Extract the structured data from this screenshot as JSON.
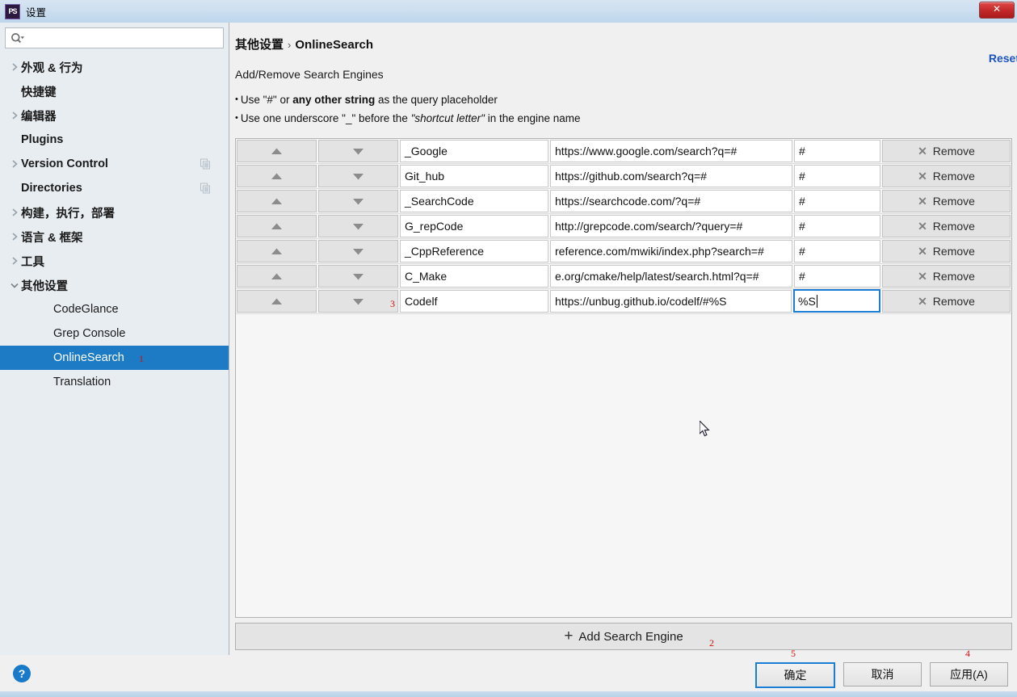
{
  "window": {
    "title": "设置",
    "app_icon": "PS",
    "close_label": "✕"
  },
  "sidebar": {
    "search": {
      "placeholder": "",
      "value": "",
      "icon": "search-icon"
    },
    "items": [
      {
        "label": "外观 & 行为",
        "arrow": "right",
        "bold": true,
        "child": false,
        "selected": false,
        "copy": false
      },
      {
        "label": "快捷键",
        "arrow": "none",
        "bold": true,
        "child": false,
        "selected": false,
        "copy": false
      },
      {
        "label": "编辑器",
        "arrow": "right",
        "bold": true,
        "child": false,
        "selected": false,
        "copy": false
      },
      {
        "label": "Plugins",
        "arrow": "none",
        "bold": true,
        "child": false,
        "selected": false,
        "copy": false
      },
      {
        "label": "Version Control",
        "arrow": "right",
        "bold": true,
        "child": false,
        "selected": false,
        "copy": true
      },
      {
        "label": "Directories",
        "arrow": "none",
        "bold": true,
        "child": false,
        "selected": false,
        "copy": true
      },
      {
        "label": "构建，执行，部署",
        "arrow": "right",
        "bold": true,
        "child": false,
        "selected": false,
        "copy": false
      },
      {
        "label": "语言 & 框架",
        "arrow": "right",
        "bold": true,
        "child": false,
        "selected": false,
        "copy": false
      },
      {
        "label": "工具",
        "arrow": "right",
        "bold": true,
        "child": false,
        "selected": false,
        "copy": false
      },
      {
        "label": "其他设置",
        "arrow": "down",
        "bold": true,
        "child": false,
        "selected": false,
        "copy": false
      },
      {
        "label": "CodeGlance",
        "arrow": "none",
        "bold": false,
        "child": true,
        "selected": false,
        "copy": false
      },
      {
        "label": "Grep Console",
        "arrow": "none",
        "bold": false,
        "child": true,
        "selected": false,
        "copy": false
      },
      {
        "label": "OnlineSearch",
        "arrow": "none",
        "bold": false,
        "child": true,
        "selected": true,
        "copy": false,
        "annotation": "1"
      },
      {
        "label": "Translation",
        "arrow": "none",
        "bold": false,
        "child": true,
        "selected": false,
        "copy": false
      }
    ]
  },
  "main": {
    "breadcrumb_parent": "其他设置",
    "breadcrumb_sep": "›",
    "breadcrumb_current": "OnlineSearch",
    "reset_label": "Reset",
    "section_title": "Add/Remove Search Engines",
    "hints": [
      {
        "bullet": "•",
        "pre": "Use \"#\" or ",
        "bold": "any other string",
        "post": " as the query placeholder",
        "italic": ""
      },
      {
        "bullet": "•",
        "pre": "Use one underscore \"_\" before the ",
        "bold": "",
        "italic": "\"shortcut letter\"",
        "post": " in the engine name"
      }
    ],
    "table": {
      "up_icon": "triangle-up-icon",
      "down_icon": "triangle-down-icon",
      "remove_icon": "close-x-icon",
      "remove_label": "Remove",
      "rows": [
        {
          "name": "_Google",
          "url": "https://www.google.com/search?q=#",
          "placeholder": "#",
          "focused": false
        },
        {
          "name": "Git_hub",
          "url": "https://github.com/search?q=#",
          "placeholder": "#",
          "focused": false
        },
        {
          "name": "_SearchCode",
          "url": "https://searchcode.com/?q=#",
          "placeholder": "#",
          "focused": false
        },
        {
          "name": "G_repCode",
          "url": "http://grepcode.com/search/?query=#",
          "placeholder": "#",
          "focused": false
        },
        {
          "name": "_CppReference",
          "url": "reference.com/mwiki/index.php?search=#",
          "placeholder": "#",
          "focused": false
        },
        {
          "name": "C_Make",
          "url": "e.org/cmake/help/latest/search.html?q=#",
          "placeholder": "#",
          "focused": false
        },
        {
          "name": "Codelf",
          "url": "https://unbug.github.io/codelf/#%S",
          "placeholder": "%S",
          "focused": true,
          "annotation": "3"
        }
      ]
    },
    "add_button": {
      "plus": "+",
      "label": "Add Search Engine",
      "annotation": "2"
    }
  },
  "footer": {
    "help_label": "?",
    "buttons": [
      {
        "label": "确定",
        "default": true,
        "annotation": "5"
      },
      {
        "label": "取消",
        "default": false,
        "annotation": ""
      },
      {
        "label": "应用(A)",
        "default": false,
        "annotation": "4"
      }
    ]
  }
}
